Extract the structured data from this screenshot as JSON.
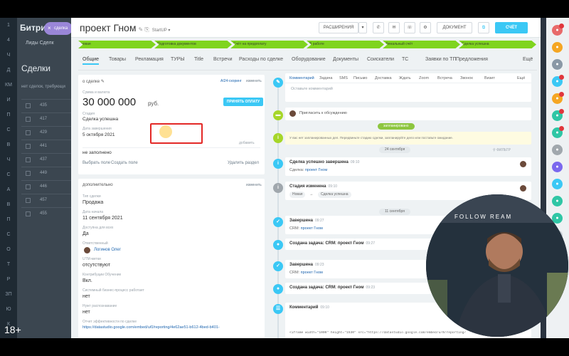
{
  "age_rating": "18+",
  "bg": {
    "logo": "Битри",
    "tabs": "Лиды   Сделк",
    "title": "Сделки",
    "sub": "нет сделок, требующи",
    "rows": [
      "435",
      "417",
      "429",
      "441",
      "437",
      "449",
      "446",
      "457",
      "455"
    ],
    "nav_letters": [
      "1",
      "4",
      "Ч",
      "Д",
      "КМ",
      "И",
      "П",
      "С",
      "В",
      "Ч",
      "С",
      "А",
      "В",
      "П",
      "С",
      "О",
      "Т",
      "Р",
      "ЗП",
      "Ю",
      "К"
    ]
  },
  "close_pill": {
    "icon": "×",
    "label": "сделка"
  },
  "deal": {
    "title": "проект Гном",
    "edit": "✎ ⎘",
    "category": "StartUP ▾",
    "buttons": [
      "РАСШИРЕНИЯ",
      "ДОКУМЕНТ",
      "СЧЁТ"
    ]
  },
  "stages": [
    "новая",
    "Подготовка документов",
    "Счёт на предоплату",
    "В работе",
    "Финальный счёт",
    "Сделка успешна"
  ],
  "tabs": [
    "Общие",
    "Товары",
    "Рекламация",
    "ТУРЫ",
    "Title",
    "Встречи",
    "Расходы по сделке",
    "Оборудование",
    "Документы",
    "Соискатели",
    "ТС",
    "Заявки по ТП",
    "Предложения",
    "Ещё"
  ],
  "about": {
    "header": "о сделке",
    "header_edit": "✎",
    "ai_scoring": "AI24-скоринг",
    "change": "изменить",
    "amount_label": "Сумма и валюта",
    "amount": "30 000 000",
    "currency": "руб.",
    "accept_btn": "ПРИНЯТЬ ОПЛАТУ",
    "stage_label": "Стадия",
    "stage_value": "Сделка успешна",
    "close_label": "Дата завершения",
    "close_value": "5 октября 2021",
    "add_label": "добавить",
    "empty": "не заполнено",
    "choose_field": "Выбрать поле",
    "create_field": "Создать поле",
    "delete_section": "Удалить раздел"
  },
  "extra": {
    "header": "дополнительно",
    "change": "изменить",
    "fields": [
      {
        "label": "Тип сделки",
        "value": "Продажа"
      },
      {
        "label": "Дата начала",
        "value": "11 сентября 2021"
      },
      {
        "label": "Доступна для всех",
        "value": "Да"
      },
      {
        "label": "Ответственный",
        "value": "Логинов Олег"
      },
      {
        "label": "UTM-метки",
        "value": "отсутствуют"
      },
      {
        "label": "Контрибуции Обучение",
        "value": "Вкл."
      },
      {
        "label": "Системный бизнес-процесс работает",
        "value": "нет"
      },
      {
        "label": "Нужт распознавание",
        "value": "нет"
      },
      {
        "label": "Отчет эффективности по сделке",
        "value": "https://datastudio.google.com/embed/u/0/reporting/4e62ae51-b612-4bed-b401-"
      }
    ]
  },
  "timeline": {
    "tabs": [
      "Комментарий",
      "Задача",
      "SMS",
      "Письмо",
      "Доставка",
      "Ждать",
      "Zoom",
      "Встреча",
      "Звонок",
      "Визит",
      "Ещё"
    ],
    "comment_placeholder": "Оставьте комментарий",
    "invite": "Пригласить к обсуждению",
    "planned": "запланировано",
    "warning": "У вас нет запланированных дел. Передвиньте стадию сделки, запланируйте дело или поставьте ожидание.",
    "date1": "24 сентября",
    "filter": "ФИЛЬТР",
    "date2": "11 сентября",
    "items": [
      {
        "title": "Сделка успешно завершена",
        "time": "09:10",
        "text": "Сделка:",
        "link": "проект Гном"
      },
      {
        "title": "Стадия изменена",
        "time": "09:10",
        "from": "Новая",
        "arrow": "→",
        "to": "Сделка успешна"
      },
      {
        "title": "Завершена",
        "time": "09:27",
        "text": "CRM:",
        "link": "проект Гном"
      },
      {
        "title": "Создана задача: CRM: проект Гном",
        "time": "09:27"
      },
      {
        "title": "Завершена",
        "time": "09:23",
        "text": "CRM:",
        "link": "проект Гном"
      },
      {
        "title": "Создана задача: CRM: проект Гном",
        "time": "09:23"
      },
      {
        "title": "Комментарий",
        "time": "09:10"
      }
    ],
    "code": "<iframe width=\"1000\" height=\"1530\" src=\"https://datastudio.google.com/embed/u/0/reporting/"
  },
  "webcam_text": "FOLLOW      REAM",
  "colors": {
    "accent": "#3bc8f5",
    "stage": "#7fd41e",
    "highlight": "#e32826"
  }
}
